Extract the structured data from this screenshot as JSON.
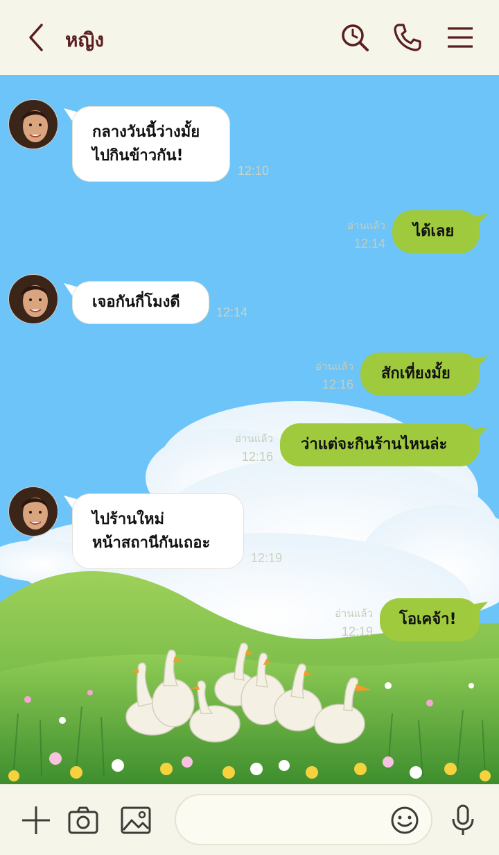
{
  "header": {
    "contact_name": "หญิง"
  },
  "messages": [
    {
      "direction": "in",
      "text_lines": [
        "กลางวันนี้ว่างมั้ย",
        "ไปกินข้าวกัน!"
      ],
      "time": "12:10"
    },
    {
      "direction": "out",
      "text": "ได้เลย",
      "read": "อ่านแล้ว",
      "time": "12:14"
    },
    {
      "direction": "in",
      "text": "เจอกันกี่โมงดี",
      "time": "12:14"
    },
    {
      "direction": "out",
      "text": "สักเที่ยงมั้ย",
      "read": "อ่านแล้ว",
      "time": "12:16"
    },
    {
      "direction": "out",
      "text": "ว่าแต่จะกินร้านไหนล่ะ",
      "read": "อ่านแล้ว",
      "time": "12:16"
    },
    {
      "direction": "in",
      "text_lines": [
        "ไปร้านใหม่",
        "หน้าสถานีกันเถอะ"
      ],
      "time": "12:19"
    },
    {
      "direction": "out",
      "text": "โอเคจ้า!",
      "read": "อ่านแล้ว",
      "time": "12:19"
    }
  ],
  "composer": {
    "placeholder": ""
  },
  "colors": {
    "header_bg": "#f5f5ea",
    "accent_dark": "#5a1e1e",
    "sky": "#6cc4f9",
    "outgoing_bubble": "#9fca3e",
    "incoming_bubble": "#ffffff"
  },
  "icons": {
    "back": "chevron-left-icon",
    "search": "search-icon",
    "call": "phone-icon",
    "menu": "hamburger-menu-icon",
    "add": "plus-icon",
    "camera": "camera-icon",
    "image": "image-icon",
    "emoji": "smiley-icon",
    "mic": "microphone-icon"
  }
}
